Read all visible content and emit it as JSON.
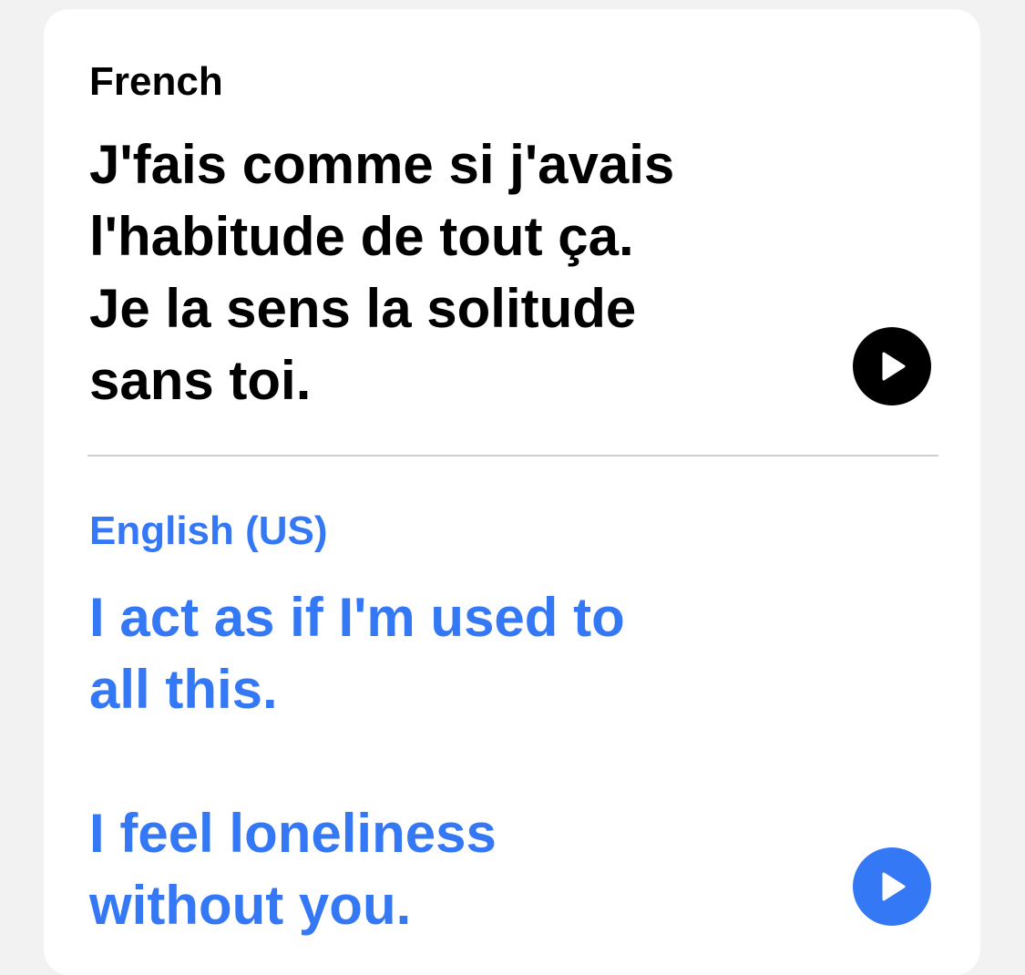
{
  "source": {
    "language": "French",
    "text": "J'fais comme si j'avais\nl'habitude de tout ça.\nJe la sens la solitude\nsans toi.",
    "play_icon": "play-icon"
  },
  "target": {
    "language": "English (US)",
    "text": "I act as if I'm used to\nall this.\n\nI feel loneliness\nwithout you.",
    "play_icon": "play-icon"
  },
  "colors": {
    "source_text": "#000000",
    "target_text": "#3478f6",
    "source_play_bg": "#000000",
    "target_play_bg": "#3478f6",
    "divider": "#cfcfcf",
    "card_bg": "#ffffff",
    "page_bg": "#f2f2f2"
  }
}
